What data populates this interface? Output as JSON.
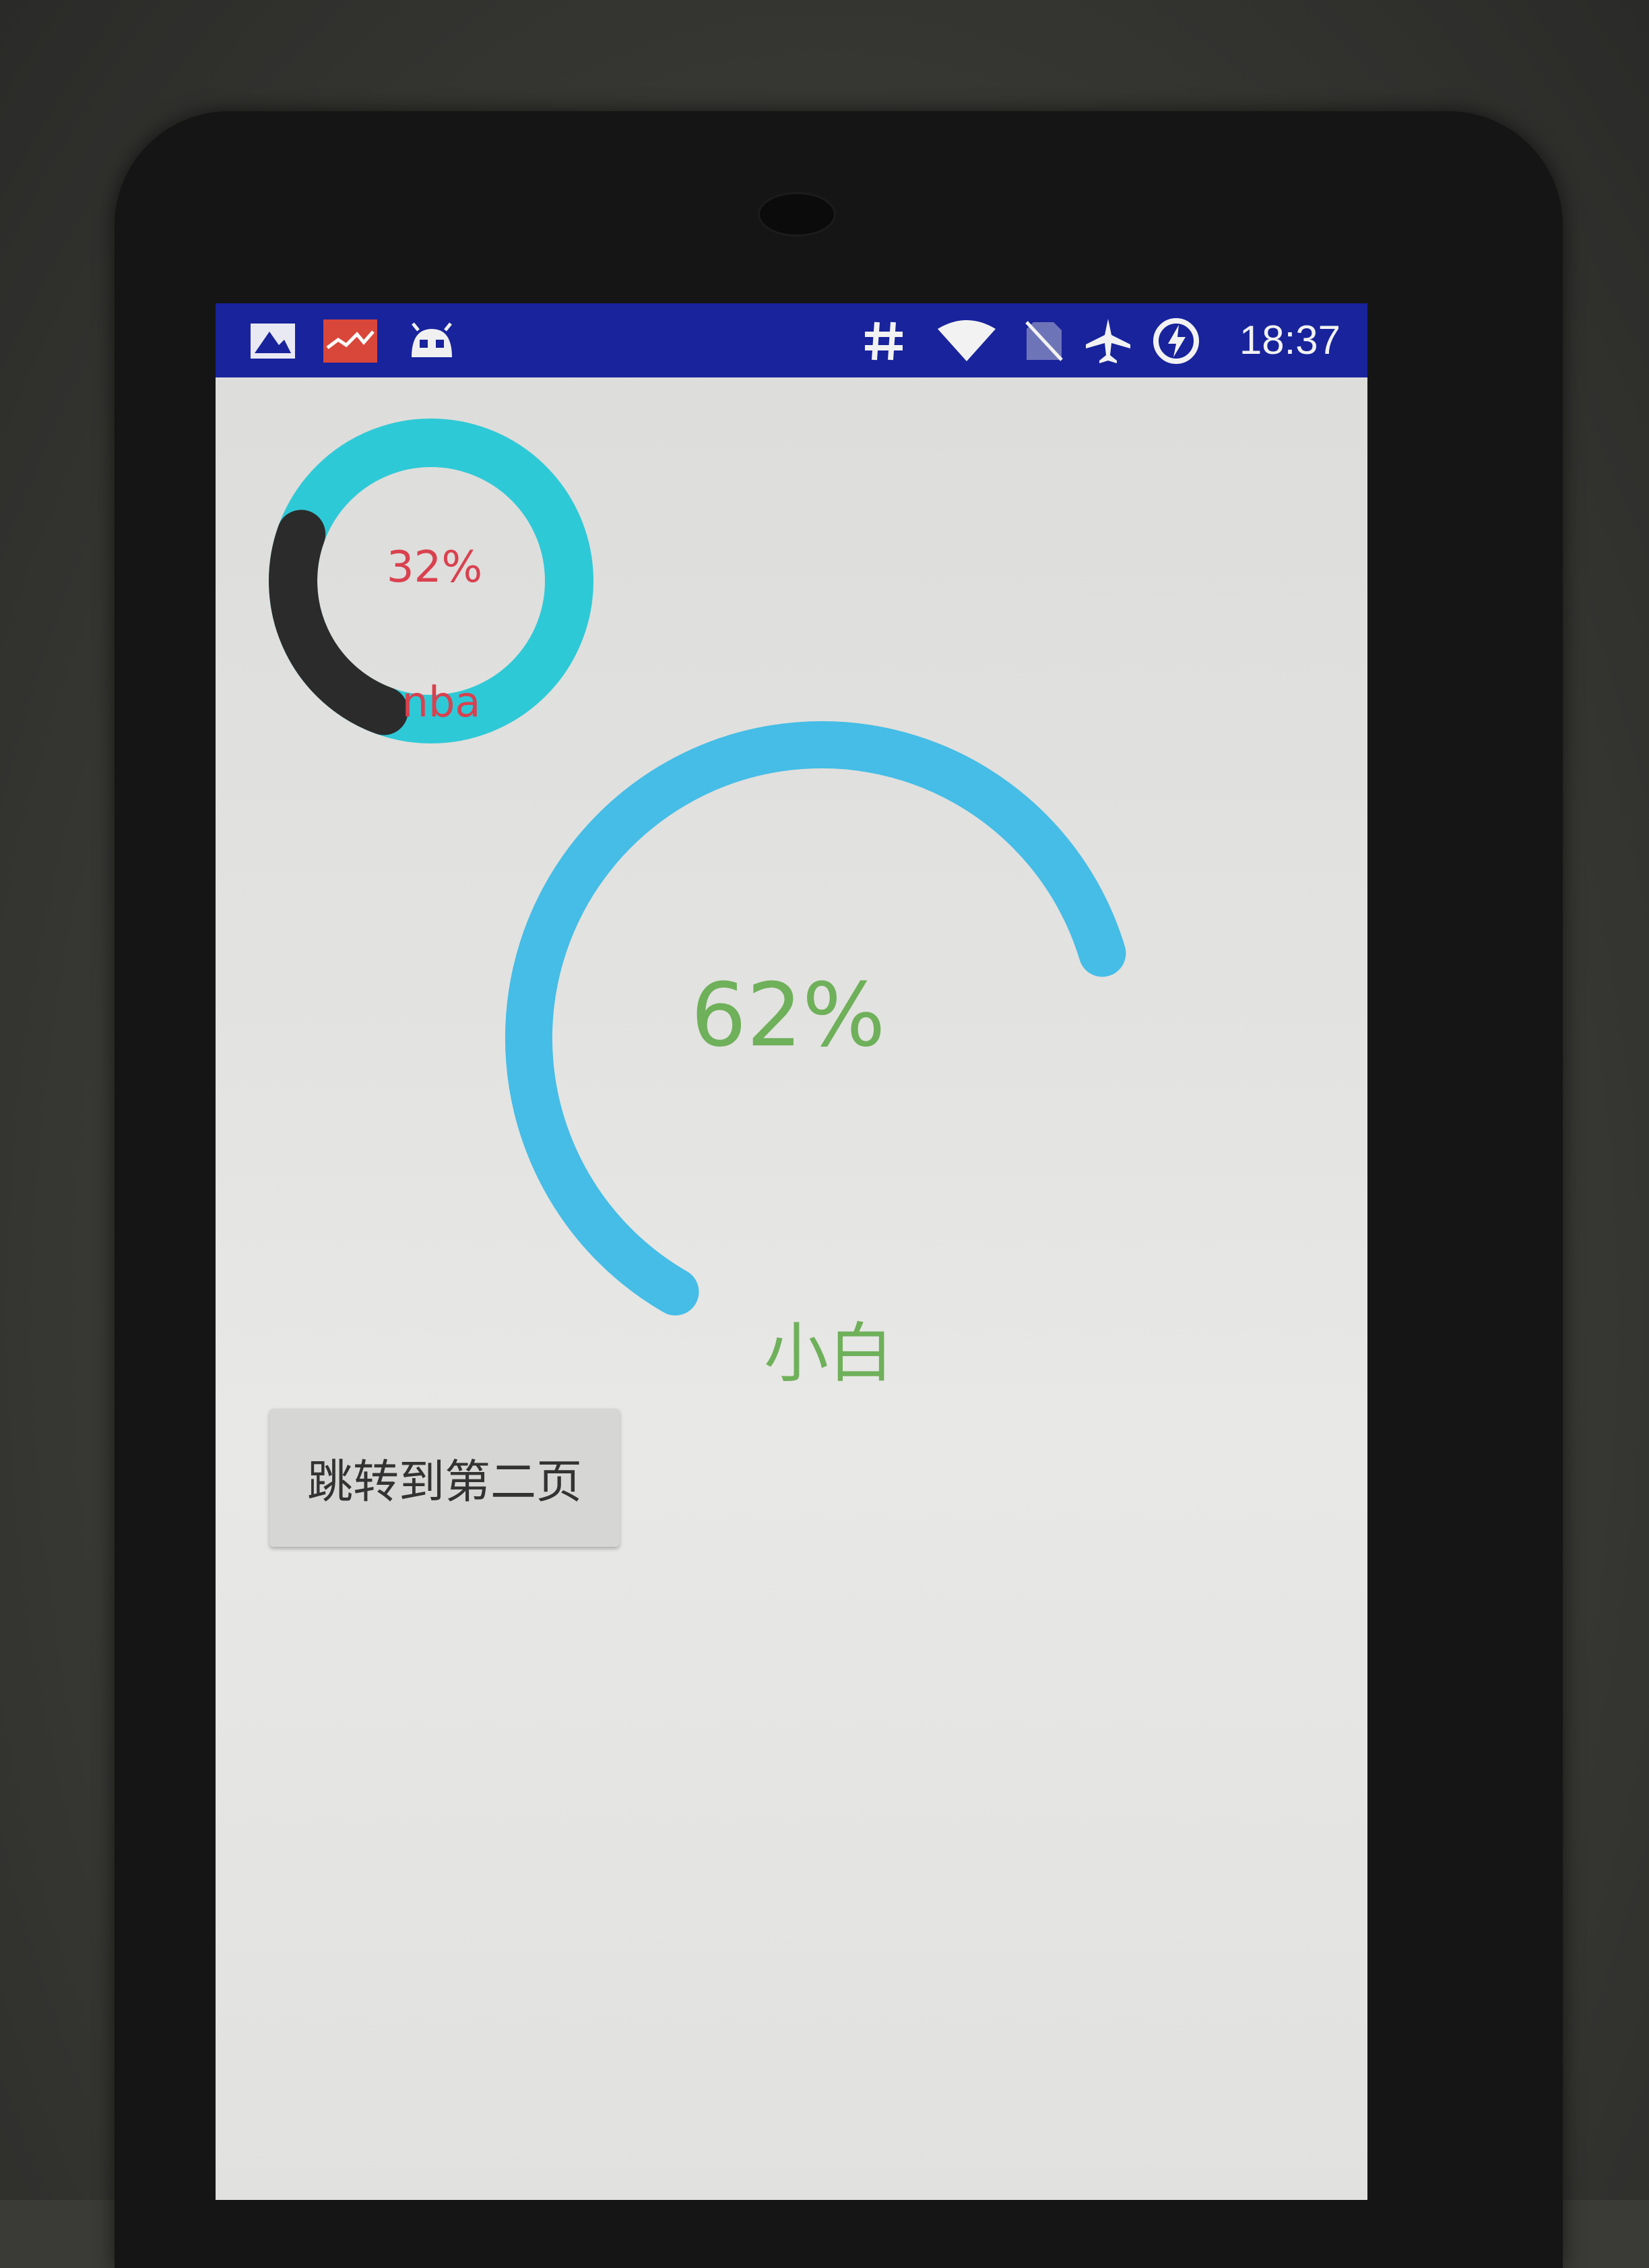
{
  "status_bar": {
    "time": "18:37",
    "left_icons": [
      "image-notification-icon",
      "stock-chart-app-icon",
      "android-debug-icon"
    ],
    "right_icons": [
      "hash-icon",
      "wifi-icon",
      "no-sim-icon",
      "airplane-mode-icon",
      "battery-charging-icon"
    ],
    "background_color": "#18239c"
  },
  "small_ring": {
    "percent_label": "32%",
    "caption": "nba",
    "progress": 0.32,
    "track_color": "#2ec9d6",
    "progress_color": "#2b2b2b",
    "text_color": "#d9414f"
  },
  "large_arc": {
    "percent_label": "62%",
    "caption": "小白",
    "progress": 0.62,
    "arc_color": "#45bde6",
    "text_color": "#6fb05a"
  },
  "jump_button": {
    "label": "跳转到第二页"
  }
}
